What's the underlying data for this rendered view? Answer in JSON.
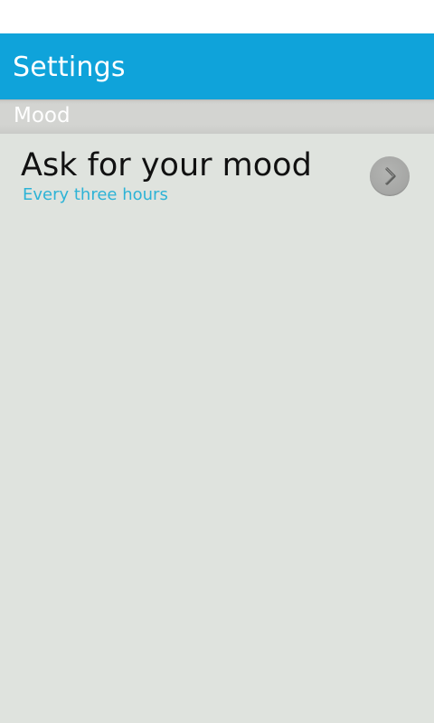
{
  "header": {
    "title": "Settings",
    "background_color": "#0fa3da"
  },
  "sections": [
    {
      "label": "Mood",
      "items": [
        {
          "title": "Ask for your mood",
          "summary": "Every three hours",
          "summary_color": "#2db3d6",
          "action_icon": "chevron-right-icon"
        }
      ]
    }
  ]
}
